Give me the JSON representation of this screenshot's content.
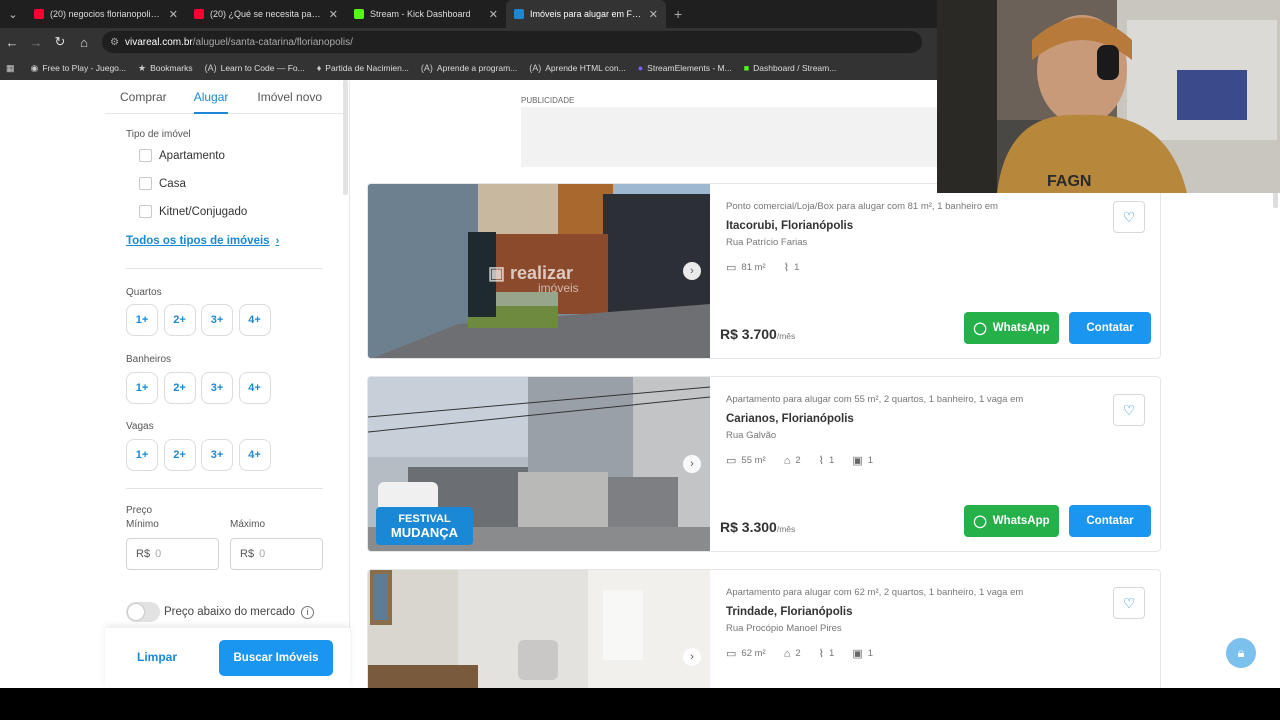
{
  "browser": {
    "tabs": [
      {
        "title": "(20) negocios florianopolis - Yo",
        "favicon_color": "#ff0033",
        "active": false
      },
      {
        "title": "(20) ¿Qué se necesita para abri",
        "favicon_color": "#ff0033",
        "active": false
      },
      {
        "title": "Stream - Kick Dashboard",
        "favicon_color": "#53fc18",
        "active": false
      },
      {
        "title": "Imóveis para alugar em Florian",
        "favicon_color": "#1a88d4",
        "active": true
      }
    ],
    "url_domain": "vivareal.com.br",
    "url_path": "/aluguel/santa-catarina/florianopolis/",
    "bookmarks": [
      {
        "label": "Free to Play - Juego...",
        "icon": "steam-icon"
      },
      {
        "label": "Bookmarks",
        "icon": "star-icon"
      },
      {
        "label": "Learn to Code — Fo...",
        "icon": "freecodecamp-icon"
      },
      {
        "label": "Partida de Nacimien...",
        "icon": "pin-icon"
      },
      {
        "label": "Aprende a program...",
        "icon": "freecodecamp-icon"
      },
      {
        "label": "Aprende HTML con...",
        "icon": "freecodecamp-icon"
      },
      {
        "label": "StreamElements - M...",
        "icon": "streamelements-icon"
      },
      {
        "label": "Dashboard / Stream...",
        "icon": "dashboard-icon"
      }
    ]
  },
  "sidebar": {
    "tabs": [
      "Comprar",
      "Alugar",
      "Imóvel novo"
    ],
    "active_tab": "Alugar",
    "tipo_label": "Tipo de imóvel",
    "tipos": [
      "Apartamento",
      "Casa",
      "Kitnet/Conjugado"
    ],
    "todos_link": "Todos os tipos de imóveis",
    "quartos_label": "Quartos",
    "banheiros_label": "Banheiros",
    "vagas_label": "Vagas",
    "chip_options": [
      "1+",
      "2+",
      "3+",
      "4+"
    ],
    "preco_label": "Preço",
    "minimo_label": "Mínimo",
    "maximo_label": "Máximo",
    "currency": "R$",
    "price_placeholder": "0",
    "toggle_label": "Preço abaixo do mercado",
    "limpar": "Limpar",
    "buscar": "Buscar Imóveis"
  },
  "publicidade": "PUBLICIDADE",
  "listings": [
    {
      "description": "Ponto comercial/Loja/Box para alugar com 81 m², 1 banheiro em",
      "location": "Itacorubi, Florianópolis",
      "street": "Rua Patrício Farias",
      "area": "81 m²",
      "quartos": "",
      "banheiros": "1",
      "vagas": "",
      "price": "R$ 3.700",
      "per": "/mês",
      "badge": ""
    },
    {
      "description": "Apartamento para alugar com 55 m², 2 quartos, 1 banheiro, 1 vaga em",
      "location": "Carianos, Florianópolis",
      "street": "Rua Galvão",
      "area": "55 m²",
      "quartos": "2",
      "banheiros": "1",
      "vagas": "1",
      "price": "R$ 3.300",
      "per": "/mês",
      "badge": "FESTIVAL DA MUDANÇA"
    },
    {
      "description": "Apartamento para alugar com 62 m², 2 quartos, 1 banheiro, 1 vaga em",
      "location": "Trindade, Florianópolis",
      "street": "Rua Procópio Manoel Pires",
      "area": "62 m²",
      "quartos": "2",
      "banheiros": "1",
      "vagas": "1",
      "price": "",
      "per": "",
      "badge": ""
    }
  ],
  "buttons": {
    "whatsapp": "WhatsApp",
    "contatar": "Contatar"
  },
  "badge_lines": [
    "FESTIVAL",
    "MUDANÇA"
  ],
  "colors": {
    "accent": "#1a88d4",
    "whatsapp": "#25b04a",
    "primary_button": "#1a95f0"
  }
}
